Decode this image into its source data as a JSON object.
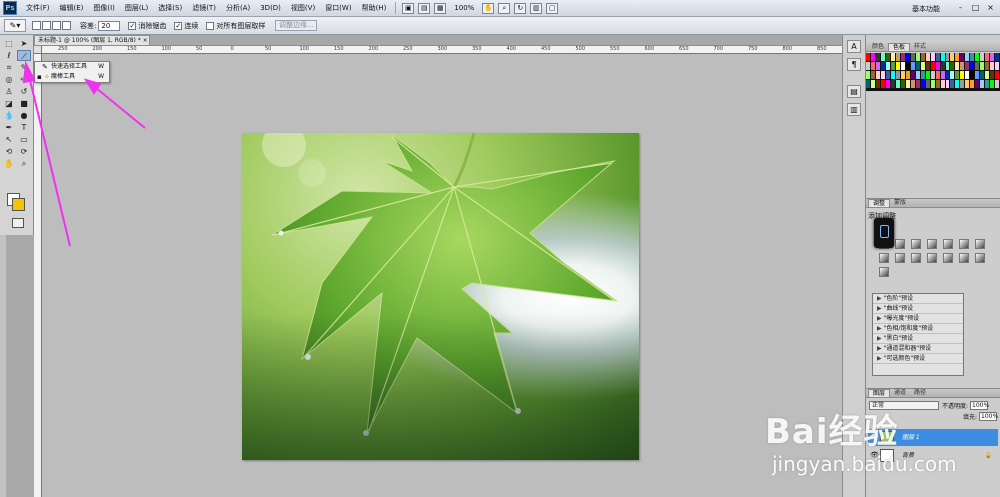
{
  "app": {
    "logo": "Ps"
  },
  "menubar": {
    "items": [
      "文件(F)",
      "编辑(E)",
      "图像(I)",
      "图层(L)",
      "选择(S)",
      "滤镜(T)",
      "分析(A)",
      "3D(D)",
      "视图(V)",
      "窗口(W)",
      "帮助(H)"
    ],
    "zoom": "100%",
    "workspace": "基本功能",
    "win_controls": [
      "-",
      "□",
      "×"
    ]
  },
  "options": {
    "tolerance_label": "容差:",
    "tolerance_value": "20",
    "antialias": "消除锯齿",
    "contiguous": "连续",
    "all_layers": "对所有图层取样",
    "refine_edge": "调整边缘..."
  },
  "document": {
    "tab_title": "未标题-1 @ 100% (图层 1, RGB/8) *  ×",
    "ruler_ticks": [
      "250",
      "200",
      "150",
      "100",
      "50",
      "0",
      "50",
      "100",
      "150",
      "200",
      "250",
      "300",
      "350",
      "400",
      "450",
      "500",
      "550",
      "600",
      "650",
      "700",
      "750",
      "800",
      "850"
    ]
  },
  "flyout": {
    "items": [
      {
        "label": "快速选择工具",
        "key": "W"
      },
      {
        "label": "魔棒工具",
        "key": "W"
      }
    ]
  },
  "panels": {
    "swatch_tabs": [
      "颜色",
      "色板",
      "样式"
    ],
    "adjust_tabs": [
      "调整",
      "蒙版"
    ],
    "adjust_title": "添加调整",
    "presets": [
      "\"色阶\"预设",
      "\"曲线\"预设",
      "\"曝光度\"预设",
      "\"色相/饱和度\"预设",
      "\"黑白\"预设",
      "\"通道混和器\"预设",
      "\"可选颜色\"预设"
    ],
    "layer_tabs": [
      "图层",
      "通道",
      "路径"
    ],
    "blend_mode": "正常",
    "opacity_label": "不透明度:",
    "opacity_value": "100%",
    "fill_label": "填充:",
    "fill_value": "100%",
    "layers": [
      {
        "name": "图层 1",
        "selected": true
      },
      {
        "name": "背景",
        "selected": false
      }
    ]
  },
  "watermark": {
    "brand": "Bai经验",
    "url": "jingyan.baidu.com"
  },
  "colors": {
    "foreground": "#f5c400",
    "background": "#ffffff",
    "annotation_arrow": "#ee33ee",
    "selection": "#3d8ee0"
  }
}
